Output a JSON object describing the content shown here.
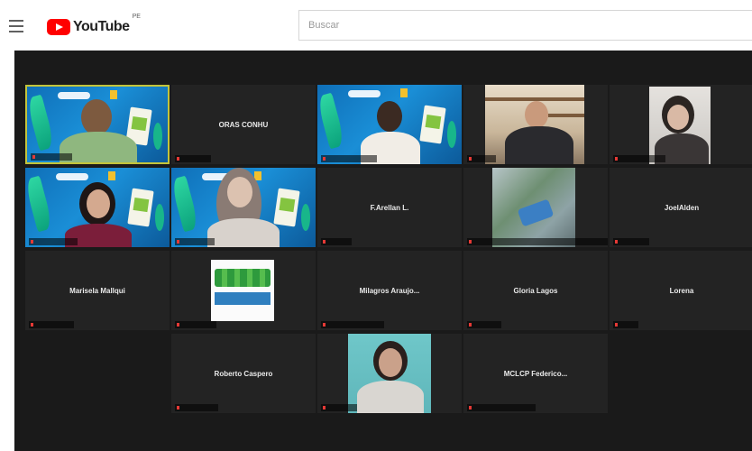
{
  "header": {
    "logo_text": "YouTube",
    "country_code": "PE",
    "search_placeholder": "Buscar"
  },
  "colors": {
    "youtube_red": "#ff0000",
    "meeting_bg": "#1a1a1a",
    "tile_bg": "#232323",
    "active_speaker": "#c4c43a"
  },
  "participants": [
    {
      "kind": "banner-video"
    },
    {
      "kind": "name",
      "name": "ORAS CONHU"
    },
    {
      "kind": "banner-video"
    },
    {
      "kind": "office-video"
    },
    {
      "kind": "camera-video"
    },
    {
      "kind": "banner-video"
    },
    {
      "kind": "banner-video"
    },
    {
      "kind": "name",
      "name": "F.Arellan L."
    },
    {
      "kind": "outdoor-video"
    },
    {
      "kind": "name",
      "name": "JoelAlden"
    },
    {
      "kind": "name",
      "name": "Marisela Mallqui"
    },
    {
      "kind": "logo-image"
    },
    {
      "kind": "name",
      "name": "Milagros  Araujo..."
    },
    {
      "kind": "name",
      "name": "Gloria Lagos"
    },
    {
      "kind": "name",
      "name": "Lorena"
    },
    {
      "kind": "name",
      "name": "Roberto Caspero"
    },
    {
      "kind": "camera-video"
    },
    {
      "kind": "name",
      "name": "MCLCP  Federico..."
    }
  ]
}
